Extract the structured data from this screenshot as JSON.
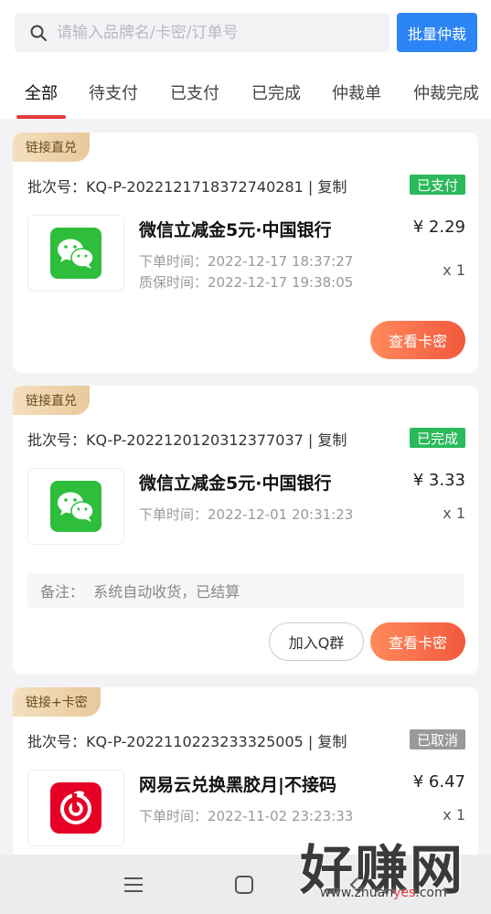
{
  "search": {
    "placeholder": "请输入品牌名/卡密/订单号",
    "value": ""
  },
  "batch_arbitration_label": "批量仲裁",
  "tabs": [
    {
      "label": "全部",
      "active": true
    },
    {
      "label": "待支付"
    },
    {
      "label": "已支付"
    },
    {
      "label": "已完成"
    },
    {
      "label": "仲裁单"
    },
    {
      "label": "仲裁完成"
    }
  ],
  "orders": [
    {
      "ribbon": "链接直兑",
      "batch_label": "批次号：",
      "batch_no": "KQ-P-2022121718372740281",
      "copy_label": "复制",
      "status": "已支付",
      "status_color": "#2aba5b",
      "product_name": "微信立减金5元·中国银行",
      "price": "¥  2.29",
      "order_time_label": "下单时间：",
      "order_time": "2022-12-17 18:37:27",
      "warranty_time_label": "质保时间：",
      "warranty_time": "2022-12-17 19:38:05",
      "quantity": "x 1",
      "view_button": "查看卡密",
      "icon": "wechat-icon"
    },
    {
      "ribbon": "链接直兑",
      "batch_label": "批次号：",
      "batch_no": "KQ-P-2022120120312377037",
      "copy_label": "复制",
      "status": "已完成",
      "status_color": "#2aba5b",
      "product_name": "微信立减金5元·中国银行",
      "price": "¥  3.33",
      "order_time_label": "下单时间：",
      "order_time": "2022-12-01 20:31:23",
      "quantity": "x 1",
      "note_label": "备注：",
      "note_text": "系统自动收货，已结算",
      "join_button": "加入Q群",
      "view_button": "查看卡密",
      "icon": "wechat-icon"
    },
    {
      "ribbon": "链接+卡密",
      "batch_label": "批次号：",
      "batch_no": "KQ-P-2022110223233325005",
      "copy_label": "复制",
      "status": "已取消",
      "status_color": "#999999",
      "product_name": "网易云兑换黑胶月|不接码",
      "price": "¥  6.47",
      "order_time_label": "下单时间：",
      "order_time": "2022-11-02 23:23:33",
      "quantity": "x 1",
      "icon": "netease-music-icon"
    }
  ],
  "navbar": [
    "menu-icon",
    "home-icon",
    "back-icon"
  ],
  "watermark": {
    "brand": "好赚网",
    "url_pre": "www.zhuan",
    "url_accent": "yes",
    "url_post": ".com"
  },
  "colors": {
    "primary_blue": "#2c85f5",
    "tab_red": "#e53a3a",
    "status_green": "#2aba5b",
    "button_orange": "#f2593c"
  }
}
